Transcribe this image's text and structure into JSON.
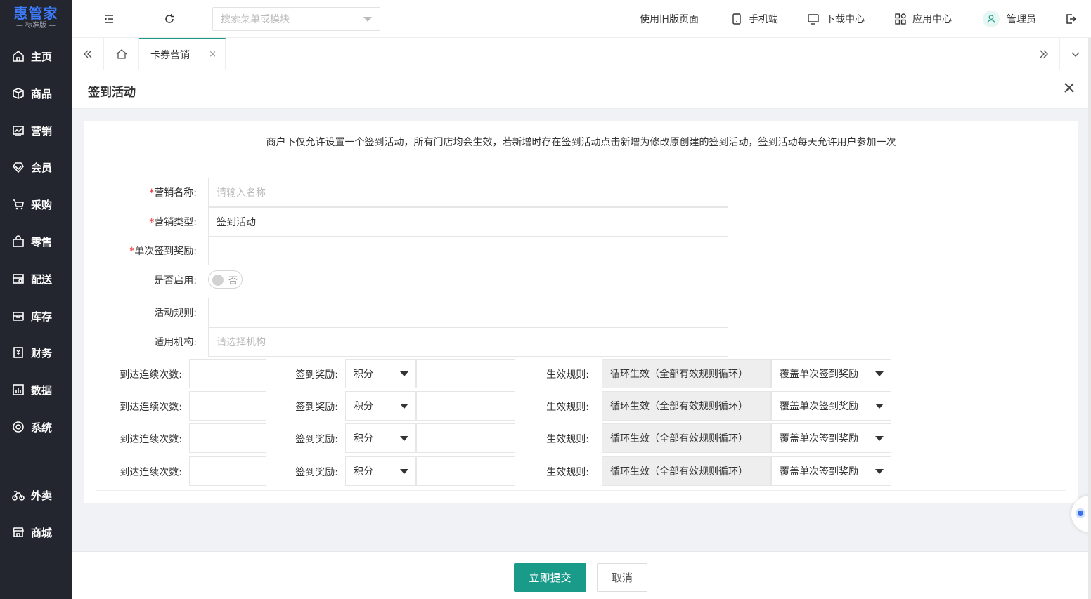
{
  "brand": {
    "name": "惠管家",
    "edition": "— 标准版 —",
    "color": "#3d7cff"
  },
  "sidebar": {
    "items": [
      {
        "label": "主页",
        "icon": "home-icon"
      },
      {
        "label": "商品",
        "icon": "box-icon"
      },
      {
        "label": "营销",
        "icon": "chart-icon"
      },
      {
        "label": "会员",
        "icon": "diamond-icon"
      },
      {
        "label": "采购",
        "icon": "cart-icon"
      },
      {
        "label": "零售",
        "icon": "bag-icon"
      },
      {
        "label": "配送",
        "icon": "delivery-icon"
      },
      {
        "label": "库存",
        "icon": "storage-icon"
      },
      {
        "label": "财务",
        "icon": "finance-icon"
      },
      {
        "label": "数据",
        "icon": "data-icon"
      },
      {
        "label": "系统",
        "icon": "settings-icon"
      },
      {
        "label": "外卖",
        "icon": "bike-icon"
      },
      {
        "label": "商城",
        "icon": "store-icon"
      }
    ]
  },
  "header": {
    "search_placeholder": "搜索菜单或模块",
    "old_page": "使用旧版页面",
    "mobile": "手机端",
    "download": "下载中心",
    "apps": "应用中心",
    "user": "管理员"
  },
  "tabs": {
    "active": "卡券营销",
    "close": "×"
  },
  "page": {
    "title": "签到活动"
  },
  "form": {
    "notice": "商户下仅允许设置一个签到活动，所有门店均会生效，若新增时存在签到活动点击新增为修改原创建的签到活动，签到活动每天允许用户参加一次",
    "required_mark": "*",
    "name_label": "营销名称:",
    "name_placeholder": "请输入名称",
    "type_label": "营销类型:",
    "type_value": "签到活动",
    "reward_label": "单次签到奖励:",
    "enable_label": "是否启用:",
    "enable_state": "否",
    "rules_label": "活动规则:",
    "org_label": "适用机构:",
    "org_placeholder": "请选择机构",
    "tiers": [
      {
        "count_label": "到达连续次数:",
        "reward_label": "签到奖励:",
        "reward_type": "积分",
        "effect_label": "生效规则:",
        "effect_rule": "循环生效（全部有效规则循环）",
        "override": "覆盖单次签到奖励"
      },
      {
        "count_label": "到达连续次数:",
        "reward_label": "签到奖励:",
        "reward_type": "积分",
        "effect_label": "生效规则:",
        "effect_rule": "循环生效（全部有效规则循环）",
        "override": "覆盖单次签到奖励"
      },
      {
        "count_label": "到达连续次数:",
        "reward_label": "签到奖励:",
        "reward_type": "积分",
        "effect_label": "生效规则:",
        "effect_rule": "循环生效（全部有效规则循环）",
        "override": "覆盖单次签到奖励"
      },
      {
        "count_label": "到达连续次数:",
        "reward_label": "签到奖励:",
        "reward_type": "积分",
        "effect_label": "生效规则:",
        "effect_rule": "循环生效（全部有效规则循环）",
        "override": "覆盖单次签到奖励"
      }
    ]
  },
  "footer": {
    "submit": "立即提交",
    "cancel": "取消"
  },
  "colors": {
    "primary": "#1a9b8a",
    "sidebar": "#23262e",
    "required": "#e22222"
  }
}
